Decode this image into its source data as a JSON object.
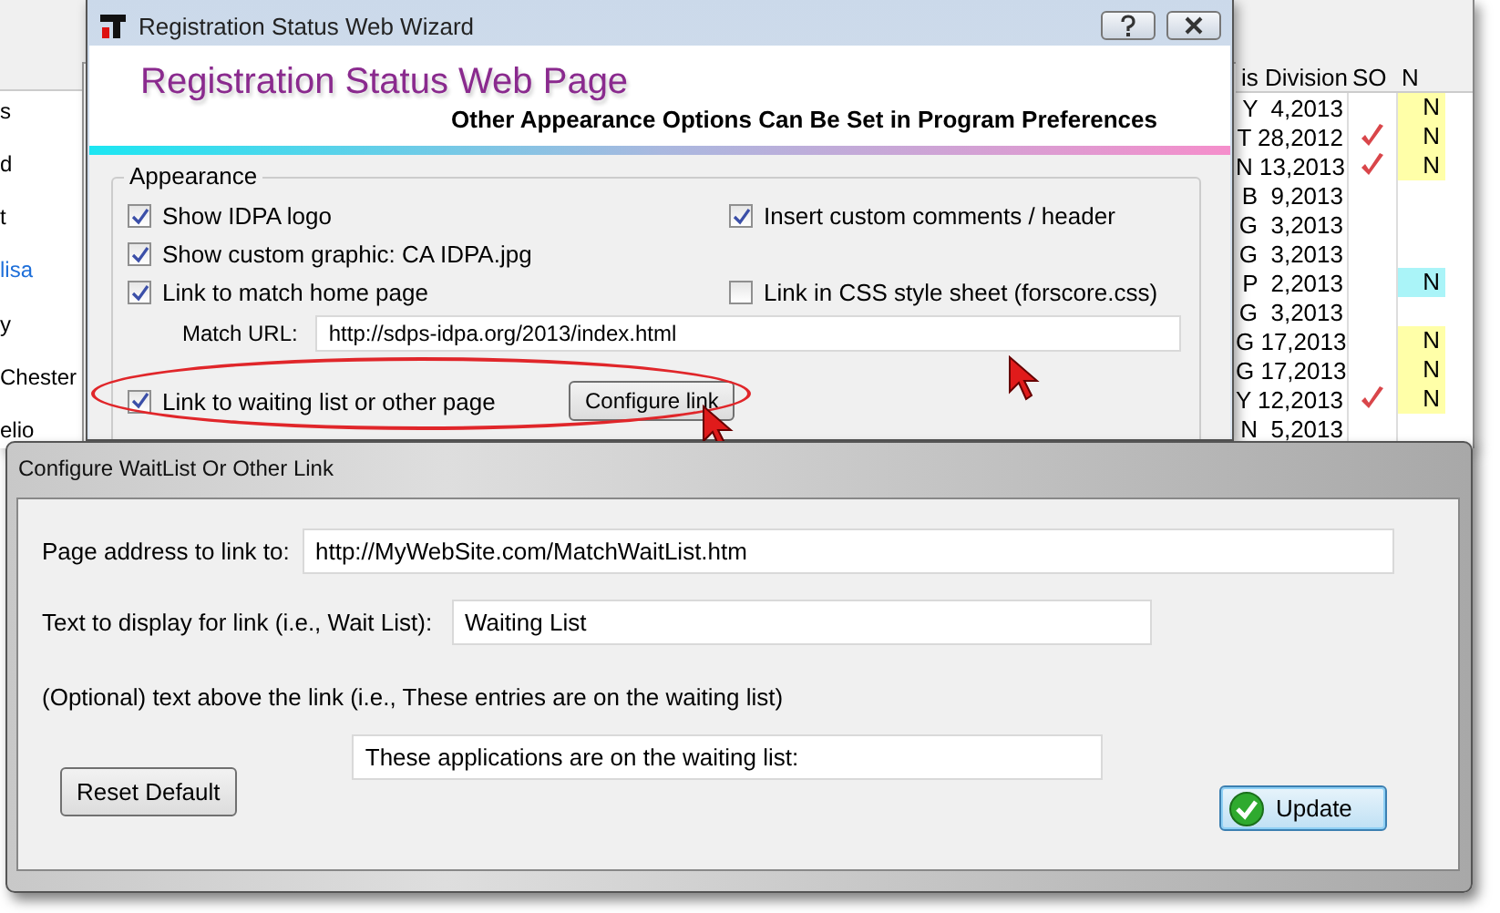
{
  "background_app": {
    "list_items": [
      {
        "label": "s",
        "highlighted": false
      },
      {
        "label": "d",
        "highlighted": false
      },
      {
        "label": "t",
        "highlighted": false
      },
      {
        "label": "lisa",
        "highlighted": true
      },
      {
        "label": "y",
        "highlighted": false
      },
      {
        "label": "Chester",
        "highlighted": false
      },
      {
        "label": "elio",
        "highlighted": false
      }
    ],
    "table": {
      "columns": [
        "is Division",
        "SO",
        "N"
      ],
      "rows": [
        {
          "date": "Y  4,2013",
          "so_checked": false,
          "n": "N",
          "color": "#ffffa8"
        },
        {
          "date": "T 28,2012",
          "so_checked": true,
          "n": "N",
          "color": "#ffffa8"
        },
        {
          "date": "N 13,2013",
          "so_checked": true,
          "n": "N",
          "color": "#ffffa8"
        },
        {
          "date": "B  9,2013",
          "so_checked": false
        },
        {
          "date": "G  3,2013",
          "so_checked": false
        },
        {
          "date": "G  3,2013",
          "so_checked": false
        },
        {
          "date": "P  2,2013",
          "so_checked": false,
          "n": "N",
          "color": "#aaf4f8"
        },
        {
          "date": "G  3,2013",
          "so_checked": false
        },
        {
          "date": "G 17,2013",
          "so_checked": false,
          "n": "N",
          "color": "#ffffa8"
        },
        {
          "date": "G 17,2013",
          "so_checked": false,
          "n": "N",
          "color": "#ffffa8"
        },
        {
          "date": "Y 12,2013",
          "so_checked": true,
          "n": "N",
          "color": "#ffffa8"
        },
        {
          "date": "N  5,2013",
          "so_checked": false
        }
      ]
    }
  },
  "wizard": {
    "title": "Registration Status Web Wizard",
    "header_title": "Registration Status Web Page",
    "header_subtitle": "Other Appearance Options Can Be Set in Program Preferences",
    "group_title": "Appearance",
    "option_rows": [
      [
        {
          "label": "Show IDPA logo",
          "checked": true
        },
        {
          "label": "Insert custom comments / header",
          "checked": true
        }
      ],
      [
        {
          "label": "Show custom graphic: CA IDPA.jpg",
          "checked": true
        }
      ],
      [
        {
          "label": "Link to match home page",
          "checked": true
        },
        {
          "label": "Link in CSS style sheet (forscore.css)",
          "checked": false
        }
      ]
    ],
    "match_url_label": "Match URL:",
    "match_url": "http://sdps-idpa.org/2013/index.html",
    "waiting_link": {
      "label": "Link to waiting list or other page",
      "checked": true
    },
    "configure_button": "Configure link"
  },
  "dialog": {
    "title": "Configure WaitList Or Other Link",
    "address_label": "Page address to link to:",
    "address": "http://MyWebSite.com/MatchWaitList.htm",
    "display_label": "Text to display for link (i.e., Wait List):",
    "display_text": "Waiting List",
    "above_label": "(Optional) text above the link (i.e., These entries are on the waiting list)",
    "above_text": "These applications are on the waiting list:",
    "reset_button": "Reset Default",
    "update_button": "Update"
  }
}
